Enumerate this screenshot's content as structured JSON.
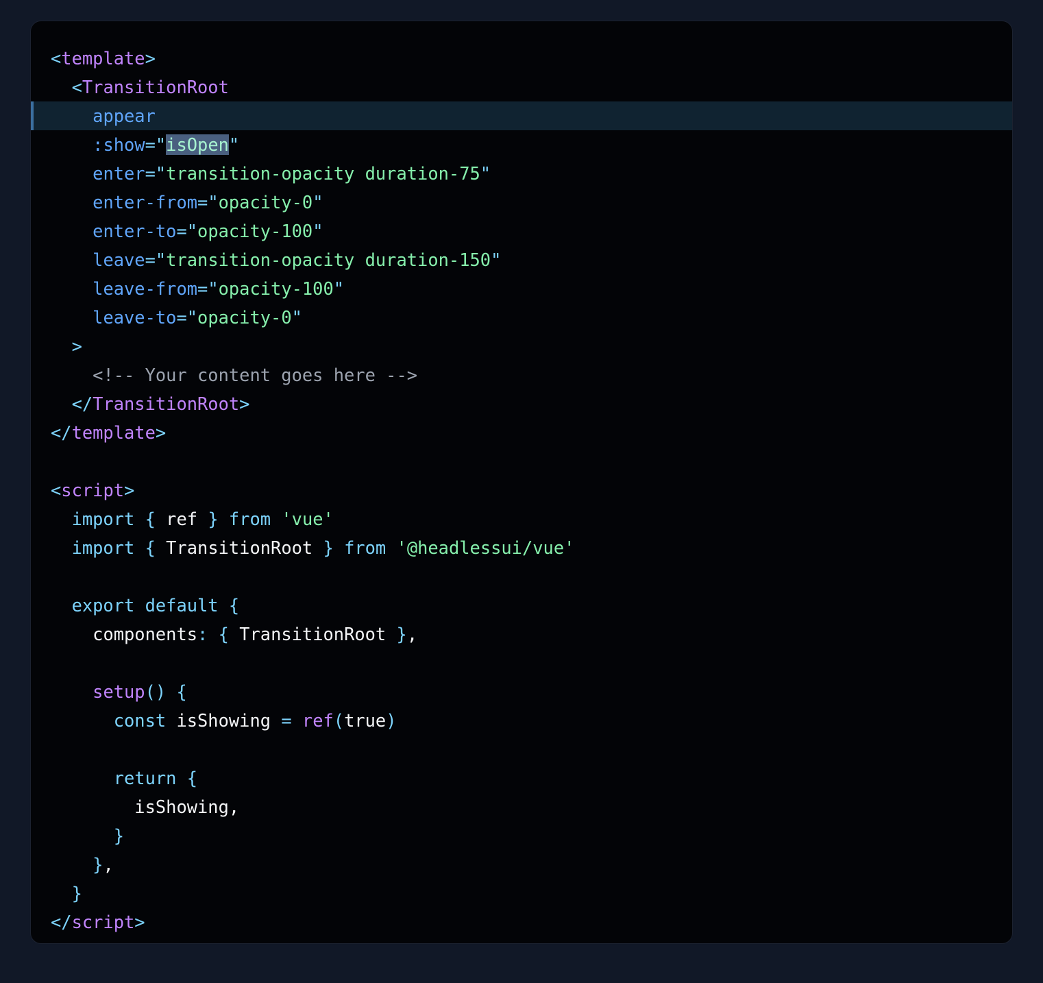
{
  "editor": {
    "highlighted_line": 3,
    "lines": [
      [
        {
          "t": "<",
          "c": "punc"
        },
        {
          "t": "template",
          "c": "tag"
        },
        {
          "t": ">",
          "c": "punc"
        }
      ],
      [
        {
          "t": "  "
        },
        {
          "t": "<",
          "c": "punc"
        },
        {
          "t": "TransitionRoot",
          "c": "tag"
        }
      ],
      [
        {
          "t": "    "
        },
        {
          "t": "appear",
          "c": "attr"
        }
      ],
      [
        {
          "t": "    "
        },
        {
          "t": ":show",
          "c": "attr"
        },
        {
          "t": "=\"",
          "c": "punc"
        },
        {
          "t": "isOpen",
          "c": "sel"
        },
        {
          "t": "\"",
          "c": "punc"
        }
      ],
      [
        {
          "t": "    "
        },
        {
          "t": "enter",
          "c": "attr"
        },
        {
          "t": "=\"",
          "c": "punc"
        },
        {
          "t": "transition-opacity duration-75",
          "c": "str"
        },
        {
          "t": "\"",
          "c": "punc"
        }
      ],
      [
        {
          "t": "    "
        },
        {
          "t": "enter-from",
          "c": "attr"
        },
        {
          "t": "=\"",
          "c": "punc"
        },
        {
          "t": "opacity-0",
          "c": "str"
        },
        {
          "t": "\"",
          "c": "punc"
        }
      ],
      [
        {
          "t": "    "
        },
        {
          "t": "enter-to",
          "c": "attr"
        },
        {
          "t": "=\"",
          "c": "punc"
        },
        {
          "t": "opacity-100",
          "c": "str"
        },
        {
          "t": "\"",
          "c": "punc"
        }
      ],
      [
        {
          "t": "    "
        },
        {
          "t": "leave",
          "c": "attr"
        },
        {
          "t": "=\"",
          "c": "punc"
        },
        {
          "t": "transition-opacity duration-150",
          "c": "str"
        },
        {
          "t": "\"",
          "c": "punc"
        }
      ],
      [
        {
          "t": "    "
        },
        {
          "t": "leave-from",
          "c": "attr"
        },
        {
          "t": "=\"",
          "c": "punc"
        },
        {
          "t": "opacity-100",
          "c": "str"
        },
        {
          "t": "\"",
          "c": "punc"
        }
      ],
      [
        {
          "t": "    "
        },
        {
          "t": "leave-to",
          "c": "attr"
        },
        {
          "t": "=\"",
          "c": "punc"
        },
        {
          "t": "opacity-0",
          "c": "str"
        },
        {
          "t": "\"",
          "c": "punc"
        }
      ],
      [
        {
          "t": "  "
        },
        {
          "t": ">",
          "c": "punc"
        }
      ],
      [
        {
          "t": "    "
        },
        {
          "t": "<!-- Your content goes here -->",
          "c": "comment"
        }
      ],
      [
        {
          "t": "  "
        },
        {
          "t": "</",
          "c": "punc"
        },
        {
          "t": "TransitionRoot",
          "c": "tag"
        },
        {
          "t": ">",
          "c": "punc"
        }
      ],
      [
        {
          "t": "</",
          "c": "punc"
        },
        {
          "t": "template",
          "c": "tag"
        },
        {
          "t": ">",
          "c": "punc"
        }
      ],
      [],
      [
        {
          "t": "<",
          "c": "punc"
        },
        {
          "t": "script",
          "c": "tag"
        },
        {
          "t": ">",
          "c": "punc"
        }
      ],
      [
        {
          "t": "  "
        },
        {
          "t": "import",
          "c": "kw"
        },
        {
          "t": " "
        },
        {
          "t": "{",
          "c": "punc"
        },
        {
          "t": " ref ",
          "c": "plain"
        },
        {
          "t": "}",
          "c": "punc"
        },
        {
          "t": " "
        },
        {
          "t": "from",
          "c": "kw"
        },
        {
          "t": " "
        },
        {
          "t": "'vue'",
          "c": "str"
        }
      ],
      [
        {
          "t": "  "
        },
        {
          "t": "import",
          "c": "kw"
        },
        {
          "t": " "
        },
        {
          "t": "{",
          "c": "punc"
        },
        {
          "t": " TransitionRoot ",
          "c": "plain"
        },
        {
          "t": "}",
          "c": "punc"
        },
        {
          "t": " "
        },
        {
          "t": "from",
          "c": "kw"
        },
        {
          "t": " "
        },
        {
          "t": "'@headlessui/vue'",
          "c": "str"
        }
      ],
      [],
      [
        {
          "t": "  "
        },
        {
          "t": "export",
          "c": "kw"
        },
        {
          "t": " "
        },
        {
          "t": "default",
          "c": "kw"
        },
        {
          "t": " "
        },
        {
          "t": "{",
          "c": "punc"
        }
      ],
      [
        {
          "t": "    "
        },
        {
          "t": "components",
          "c": "plain"
        },
        {
          "t": ":",
          "c": "punc"
        },
        {
          "t": " "
        },
        {
          "t": "{",
          "c": "punc"
        },
        {
          "t": " TransitionRoot ",
          "c": "plain"
        },
        {
          "t": "}",
          "c": "punc"
        },
        {
          "t": ",",
          "c": "plain"
        }
      ],
      [],
      [
        {
          "t": "    "
        },
        {
          "t": "setup",
          "c": "fn"
        },
        {
          "t": "() {",
          "c": "punc"
        }
      ],
      [
        {
          "t": "      "
        },
        {
          "t": "const",
          "c": "kw"
        },
        {
          "t": " isShowing ",
          "c": "plain"
        },
        {
          "t": "=",
          "c": "punc"
        },
        {
          "t": " "
        },
        {
          "t": "ref",
          "c": "fn"
        },
        {
          "t": "(",
          "c": "punc"
        },
        {
          "t": "true",
          "c": "plain"
        },
        {
          "t": ")",
          "c": "punc"
        }
      ],
      [],
      [
        {
          "t": "      "
        },
        {
          "t": "return",
          "c": "kw"
        },
        {
          "t": " "
        },
        {
          "t": "{",
          "c": "punc"
        }
      ],
      [
        {
          "t": "        "
        },
        {
          "t": "isShowing,",
          "c": "plain"
        }
      ],
      [
        {
          "t": "      "
        },
        {
          "t": "}",
          "c": "punc"
        }
      ],
      [
        {
          "t": "    "
        },
        {
          "t": "}",
          "c": "punc"
        },
        {
          "t": ",",
          "c": "plain"
        }
      ],
      [
        {
          "t": "  "
        },
        {
          "t": "}",
          "c": "punc"
        }
      ],
      [
        {
          "t": "</",
          "c": "punc"
        },
        {
          "t": "script",
          "c": "tag"
        },
        {
          "t": ">",
          "c": "punc"
        }
      ]
    ]
  }
}
